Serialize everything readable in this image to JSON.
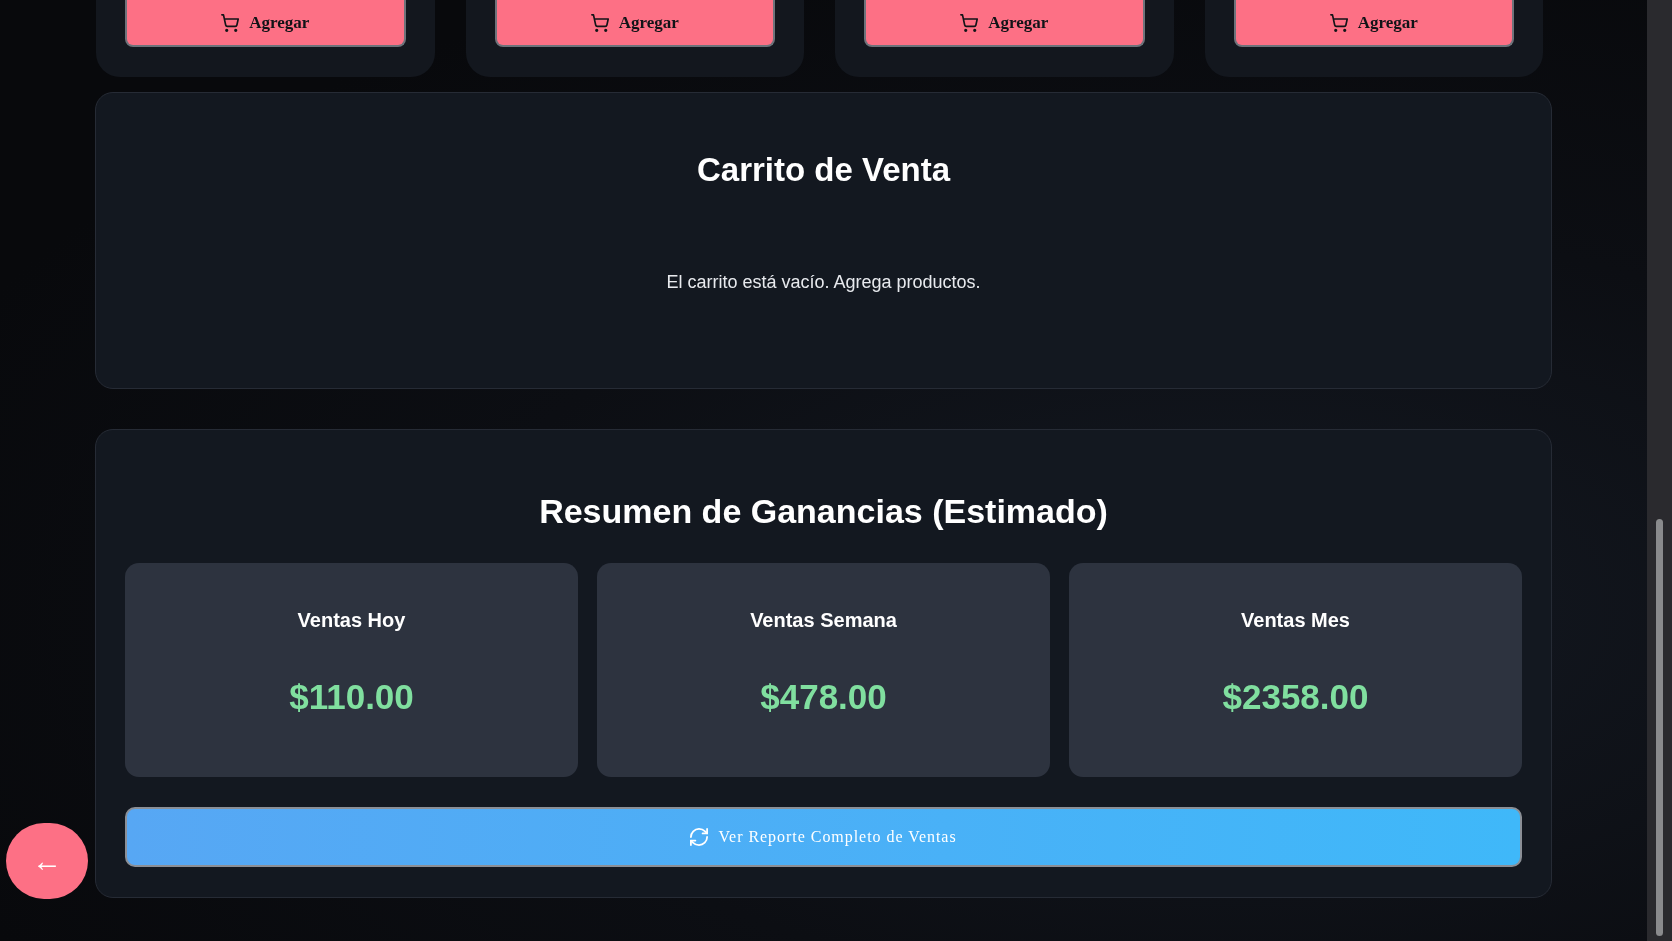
{
  "products": [
    {
      "button": "Agregar"
    },
    {
      "button": "Agregar"
    },
    {
      "button": "Agregar"
    },
    {
      "button": "Agregar"
    }
  ],
  "cart": {
    "title": "Carrito de Venta",
    "empty_message": "El carrito está vacío. Agrega productos."
  },
  "summary": {
    "title": "Resumen de Ganancias (Estimado)",
    "stats": [
      {
        "label": "Ventas Hoy",
        "value": "$110.00"
      },
      {
        "label": "Ventas Semana",
        "value": "$478.00"
      },
      {
        "label": "Ventas Mes",
        "value": "$2358.00"
      }
    ],
    "report_button": "Ver Reporte Completo de Ventas"
  },
  "back_button": "←"
}
